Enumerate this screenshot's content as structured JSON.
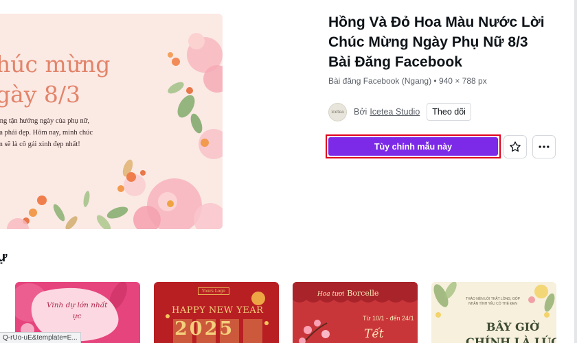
{
  "preview": {
    "heading_lines": [
      "húc mừng",
      "gày 8/3"
    ],
    "body_lines": [
      "ững tận hưởng ngày của phụ nữ,",
      "ủa phái đẹp. Hôm nay, mình chúc",
      "ạn sẽ là cô gái xinh đẹp nhất!"
    ]
  },
  "template": {
    "title_lines": [
      "Hồng Và Đỏ Hoa Màu Nước Lời",
      "Chúc Mừng Ngày Phụ Nữ 8/3",
      "Bài Đăng Facebook"
    ],
    "meta": "Bài đăng Facebook (Ngang) • 940 × 788 px"
  },
  "author": {
    "avatar_text": "icetea",
    "by_label": "Bởi",
    "name": "Icetea Studio",
    "follow_label": "Theo dõi"
  },
  "actions": {
    "customize_label": "Tùy chỉnh mẫu này",
    "star_icon": "star-icon",
    "more_icon": "more-horizontal-icon"
  },
  "related": {
    "heading": "ự",
    "cards": [
      {
        "lines": [
          "Vinh dự lớn nhất",
          "ực"
        ]
      },
      {
        "top": "Yours Logo",
        "line1": "HAPPY NEW YEAR",
        "line2": "2025"
      },
      {
        "brand_prefix": "Hoa tươi",
        "brand": "Borcelle",
        "date": "Từ 10/1 - đến 24/1",
        "tet": "Tết"
      },
      {
        "small_lines": [
          "THÁO NÉN LÒI THẬT LÒNG, GÓP",
          "NHẬN TÍNH YÊU CÓ THỂ ĐEN"
        ],
        "big_lines": [
          "BÂY GIỜ",
          "CHÍNH LÀ LÚC"
        ]
      }
    ]
  },
  "status_bar": {
    "url": "Q-rUo-uE&template=E..."
  },
  "colors": {
    "accent": "#7c2ae8",
    "highlight_border": "#e0001b",
    "preview_bg": "#fbe9e4",
    "preview_heading": "#e2846a"
  }
}
